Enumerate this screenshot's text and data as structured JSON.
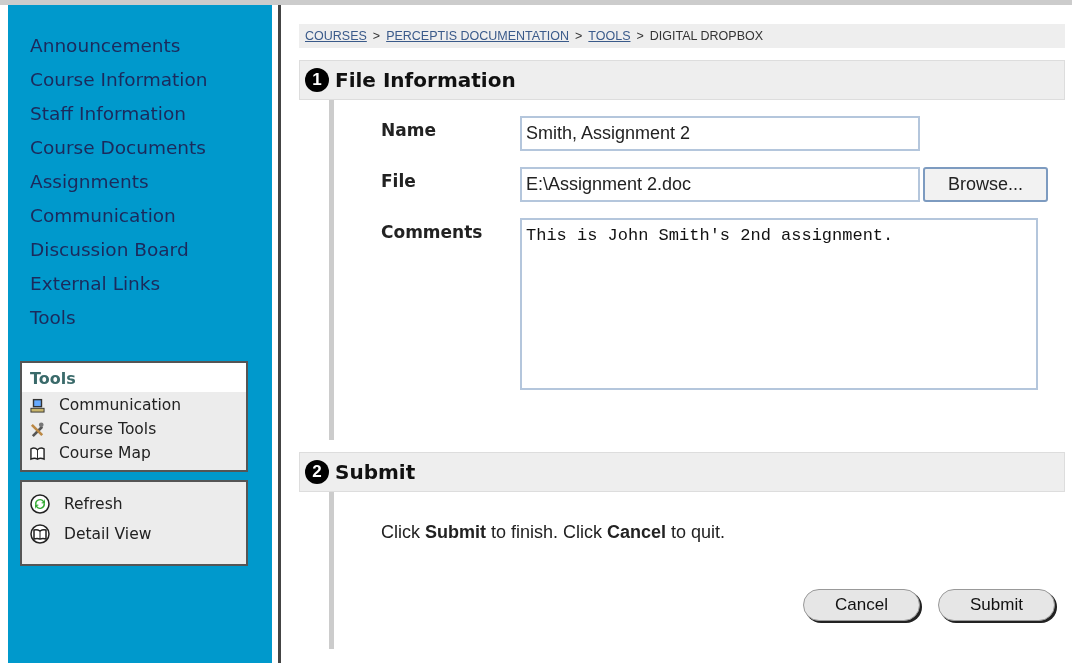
{
  "sidebar": {
    "items": [
      "Announcements",
      "Course Information",
      "Staff Information",
      "Course Documents",
      "Assignments",
      "Communication",
      "Discussion Board",
      "External Links",
      "Tools"
    ],
    "tools_box": {
      "title": "Tools",
      "items": [
        "Communication",
        "Course Tools",
        "Course Map"
      ]
    },
    "actions_box": {
      "items": [
        "Refresh",
        "Detail View"
      ]
    }
  },
  "breadcrumb": [
    {
      "label": "COURSES",
      "kind": "link"
    },
    {
      "label": ">",
      "kind": "separator"
    },
    {
      "label": "PERCEPTIS DOCUMENTATION",
      "kind": "link"
    },
    {
      "label": ">",
      "kind": "separator"
    },
    {
      "label": "TOOLS",
      "kind": "link"
    },
    {
      "label": ">",
      "kind": "separator"
    },
    {
      "label": "DIGITAL DROPBOX",
      "kind": "current"
    }
  ],
  "file_section": {
    "number": "1",
    "title": "File Information",
    "fields": [
      {
        "label": "Name",
        "kind": "text",
        "value": "Smith, Assignment 2"
      },
      {
        "label": "File",
        "kind": "file",
        "value": "E:\\Assignment 2.doc",
        "button": "Browse..."
      },
      {
        "label": "Comments",
        "kind": "textarea",
        "value": "This is John Smith's 2nd assignment."
      }
    ]
  },
  "submit_section": {
    "number": "2",
    "title": "Submit",
    "instruction": "Click **Submit** to finish. Click **Cancel** to quit.",
    "buttons": [
      "Cancel",
      "Submit"
    ]
  }
}
